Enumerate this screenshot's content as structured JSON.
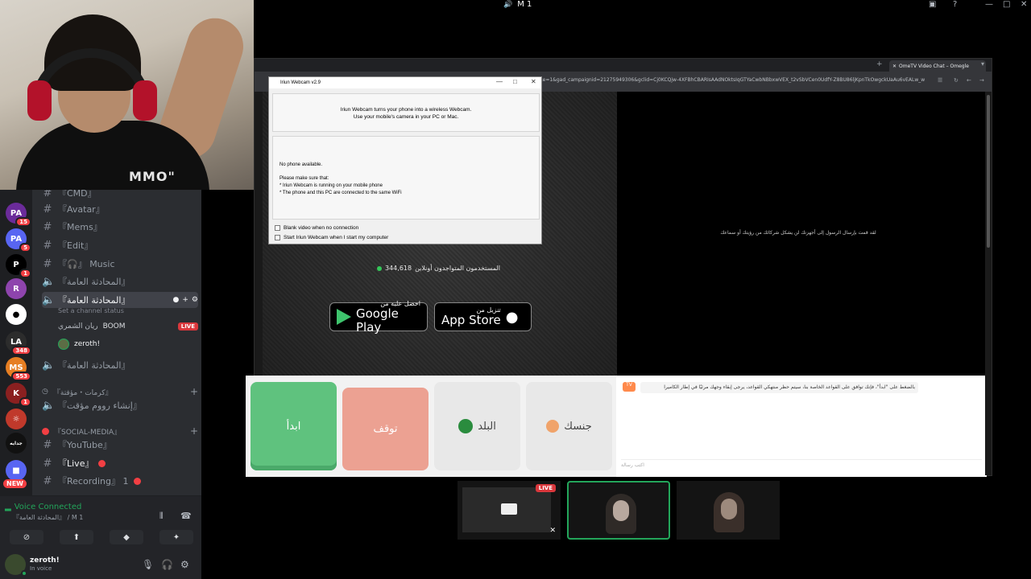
{
  "topbar": {
    "channel_label": "M 1"
  },
  "webcam": {
    "shirt_text": "MMO\""
  },
  "servers": [
    {
      "label": "PA",
      "color": "#6b2b9a",
      "badge": "15"
    },
    {
      "label": "PA",
      "color": "#5865f2",
      "badge": "5"
    },
    {
      "label": "P",
      "color": "#000000",
      "badge": "1"
    },
    {
      "label": "R",
      "color": "#8e44ad",
      "badge": ""
    },
    {
      "label": "●",
      "color": "#ffffff",
      "badge": ""
    },
    {
      "label": "LA",
      "color": "#2c2c2c",
      "badge": "348"
    },
    {
      "label": "MS",
      "color": "#e67e22",
      "badge": "553"
    },
    {
      "label": "K",
      "color": "#8b2020",
      "badge": "1"
    },
    {
      "label": "☼",
      "color": "#c0392b",
      "badge": ""
    },
    {
      "label": "جدايه",
      "color": "#111111",
      "badge": ""
    },
    {
      "label": "■",
      "color": "#5865f2",
      "badge": ""
    }
  ],
  "new_badge": "NEW",
  "channels": {
    "c0": "『CMD』",
    "c1": "『Avatar』",
    "c2": "『Mems』",
    "c3": "『Edit』",
    "c4": "『🎧』 Music",
    "v1": "『المحادثة العامة』",
    "v2": "『المحادثة العامة』",
    "v2_status": "Set a channel status",
    "u1": "ريان الشمري",
    "u1_tag": "BOOM",
    "u1_live": "LIVE",
    "u2": "zeroth!",
    "v3": "『المحادثة العامة』",
    "cat1": "『كرمات・مؤقتة』",
    "c5": "『إنشاء رووم مؤقت』",
    "cat2": "『SOCIAL-MEDIA』",
    "c6": "『YouTube』",
    "c7": "『Live』",
    "c8": "『Recording』 1"
  },
  "voice": {
    "title": "Voice Connected",
    "sub": "『المحادثة العامة』 / M 1"
  },
  "user": {
    "name": "zeroth!",
    "status": "In voice"
  },
  "browser": {
    "tab_title": "OmeTV Video Chat – Omegle",
    "url": "rce=1&gad_campaignid=21275949306&gclid=Cj0KCQjw-4XFBhCBARIsAAdNOktsIqGTYaCwbNBbxwVEX_t2vSbVCen0UdfY-Z8BU86ljKpnTkOwgckUaAu6vEALw_wcB"
  },
  "right_msg": "لقد قمت بإرسال الرسول إلى أجهزتك لن يشكل شركائك من رؤيتك أو سماعك",
  "online": {
    "count": "344,618",
    "label": "المستخدمون المتواجدون أونلاين"
  },
  "stores": {
    "google_small": "احصل عليه من",
    "google_big": "Google Play",
    "apple_small": "تنزيل من",
    "apple_big": "App Store"
  },
  "buttons": {
    "start": "ابدأ",
    "stop": "توقف",
    "country": "البلد",
    "gender": "جنسك"
  },
  "chat": {
    "message": "بالضغط على \"ابدأ\"، فإنك توافق على القواعد الخاصة بنا، سيتم حظر منتهكي القواعد، يرجى إبقاء وجهك مرئيًا في إطار الكاميرا",
    "placeholder": "اكتب رسالة"
  },
  "dialog": {
    "title": "Iriun Webcam v2.9",
    "intro1": "Iriun Webcam turns your phone into a wireless Webcam.",
    "intro2": "Use your mobile's camera in your PC or Mac.",
    "no_phone": "No phone available.",
    "make_sure": "Please make sure that:",
    "bullet1": "* Iriun Webcam is running on your mobile phone",
    "bullet2": "* The phone and this PC are connected to the same WiFi",
    "cb1": "Blank video when no connection",
    "cb2": "Start Iriun Webcam when I start my computer"
  },
  "thumbs": {
    "live": "LIVE"
  }
}
